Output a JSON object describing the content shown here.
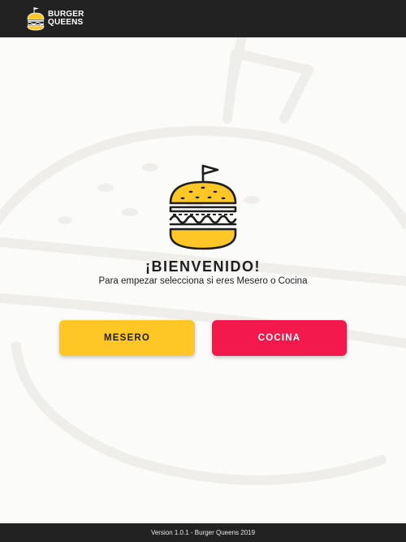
{
  "header": {
    "brand_line1": "BURGER",
    "brand_line2": "QUEENS",
    "logo_icon": "burger-flag-icon"
  },
  "welcome": {
    "title": "¡BIENVENIDO!",
    "subtitle": "Para empezar selecciona si eres Mesero o Cocina",
    "hero_icon": "burger-flag-icon"
  },
  "actions": {
    "mesero_label": "MESERO",
    "cocina_label": "COCINA"
  },
  "footer": {
    "text": "Version 1.0.1 - Burger Queens 2019"
  },
  "colors": {
    "header_bg": "#222222",
    "page_bg": "#fbfbf9",
    "accent_yellow": "#ffc726",
    "accent_red": "#f4194d",
    "text_dark": "#1e1e1e"
  }
}
